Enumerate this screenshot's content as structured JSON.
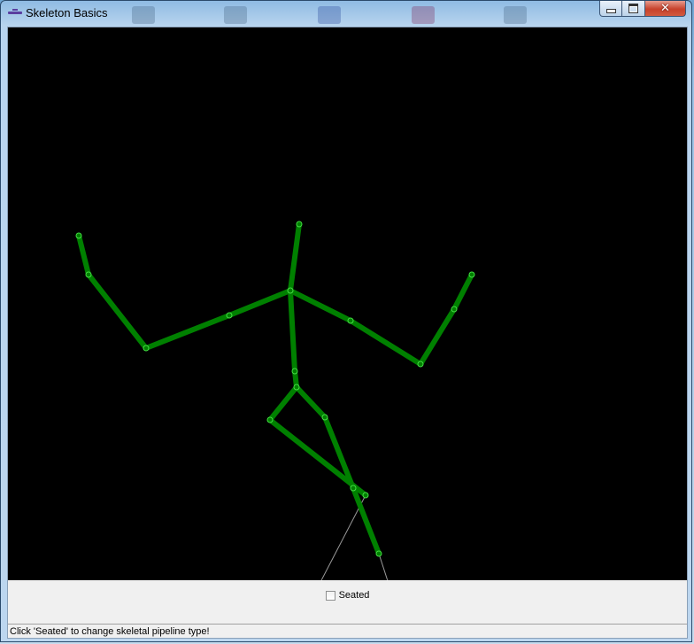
{
  "window": {
    "title": "Skeleton Basics"
  },
  "controls": {
    "minimize_icon": "minimize-icon",
    "maximize_icon": "maximize-icon",
    "close_label": "✕"
  },
  "canvas": {
    "background": "#000000",
    "bone_color": "#008000",
    "joint_color": "#44dd44",
    "inferred_color": "#9a9a9a"
  },
  "seated": {
    "label": "Seated",
    "checked": false
  },
  "status": {
    "text": "Click 'Seated' to change skeletal pipeline type!"
  }
}
